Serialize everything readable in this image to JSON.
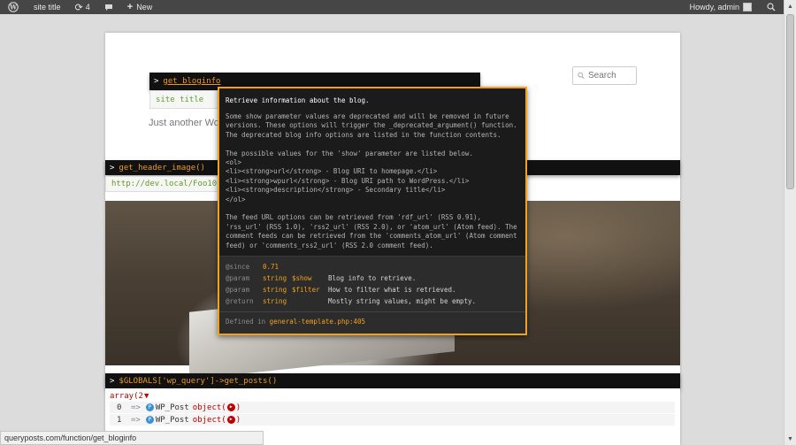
{
  "admin_bar": {
    "site_title": "site title",
    "updates_count": "4",
    "new_label": "New",
    "greeting": "Howdy, admin",
    "icons": [
      "wordpress-logo-icon",
      "refresh-icon",
      "comment-bubble-icon",
      "plus-icon",
      "search-icon"
    ]
  },
  "page": {
    "tagline": "Just another WordP",
    "search_placeholder": "Search"
  },
  "panel_bloginfo": {
    "caret": ">",
    "function": "get_bloginfo",
    "value": "site title"
  },
  "panel_header_image": {
    "caret": ">",
    "function": "get_header_image()",
    "value": "http://dev.local/Foo10/"
  },
  "tooltip": {
    "summary": "Retrieve information about the blog.",
    "description": "Some show parameter values are deprecated and will be removed in future\nversions. These options will trigger the _deprecated_argument() function.\nThe deprecated blog info options are listed in the function contents.\n\nThe possible values for the 'show' parameter are listed below.\n<ol>\n<li><strong>url</strong> - Blog URI to homepage.</li>\n<li><strong>wpurl</strong> - Blog URI path to WordPress.</li>\n<li><strong>description</strong> - Secondary title</li>\n</ol>\n\nThe feed URL options can be retrieved from 'rdf_url' (RSS 0.91),\n'rss_url' (RSS 1.0), 'rss2_url' (RSS 2.0), or 'atom_url' (Atom feed). The\ncomment feeds can be retrieved from the 'comments_atom_url' (Atom comment\nfeed) or 'comments_rss2_url' (RSS 2.0 comment feed).",
    "since_tag": "@since",
    "since_value": "0.71",
    "params": [
      {
        "tag": "@param",
        "type": "string",
        "var": "$show",
        "desc": "Blog info to retrieve."
      },
      {
        "tag": "@param",
        "type": "string",
        "var": "$filter",
        "desc": "How to filter what is retrieved."
      }
    ],
    "return": {
      "tag": "@return",
      "type": "string",
      "desc": "Mostly string values, might be empty."
    },
    "defined_label": "Defined in",
    "defined_file": "general-template.php:405"
  },
  "panel_posts": {
    "caret": ">",
    "expression": "$GLOBALS['wp_query']->get_posts()",
    "array_label": "array(2",
    "items": [
      {
        "index": "0",
        "arrow": "=>",
        "class_badge": "P",
        "class_name": "WP_Post",
        "type": "object(",
        "close": ")"
      },
      {
        "index": "1",
        "arrow": "=>",
        "class_badge": "P",
        "class_name": "WP_Post",
        "type": "object(",
        "close": ")"
      }
    ]
  },
  "status_bar": {
    "url": "queryposts.com/function/get_bloginfo"
  },
  "colors": {
    "accent": "#f0a21c",
    "admin_bar": "#464646",
    "value_green": "#5f9c2c",
    "array_red": "#bb0000"
  }
}
